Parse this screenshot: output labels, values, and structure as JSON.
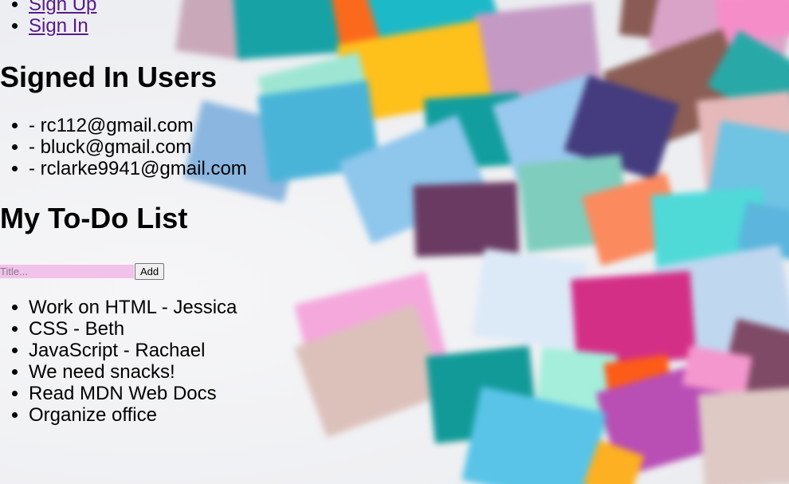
{
  "nav": {
    "items": [
      {
        "label": "Sign Up"
      },
      {
        "label": "Sign In"
      }
    ]
  },
  "signed_in": {
    "heading": "Signed In Users",
    "users": [
      {
        "label": "- rc112@gmail.com"
      },
      {
        "label": "- bluck@gmail.com"
      },
      {
        "label": "- rclarke9941@gmail.com"
      }
    ]
  },
  "todo": {
    "heading": "My To-Do List",
    "input": {
      "placeholder": "Title...",
      "value": ""
    },
    "add_label": "Add",
    "items": [
      {
        "label": "Work on HTML - Jessica"
      },
      {
        "label": "CSS - Beth"
      },
      {
        "label": "JavaScript - Rachael"
      },
      {
        "label": "We need snacks!"
      },
      {
        "label": "Read MDN Web Docs"
      },
      {
        "label": "Organize office"
      }
    ]
  },
  "colors": {
    "link": "#551a8b",
    "input_background": "#f1c2ea",
    "page_background": "#f1f1f3"
  }
}
